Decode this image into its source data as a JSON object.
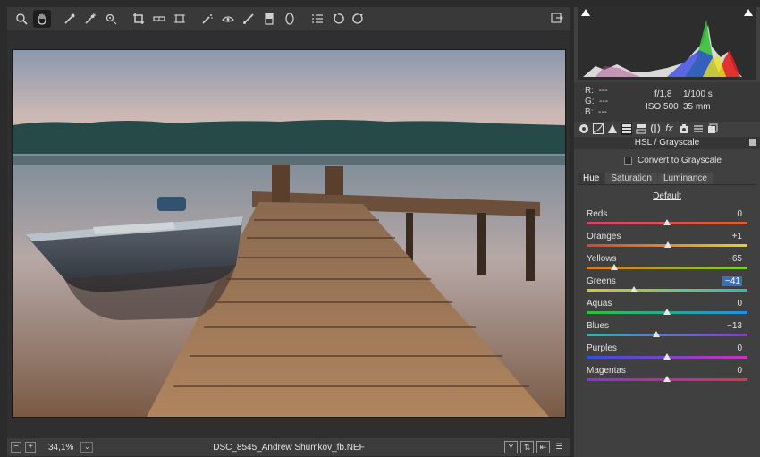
{
  "toolbar": {
    "tools": [
      {
        "name": "zoom-tool",
        "icon": "magnifier-icon"
      },
      {
        "name": "hand-tool",
        "icon": "hand-icon",
        "active": true
      },
      {
        "name": "white-balance-tool",
        "icon": "eyedropper-icon"
      },
      {
        "name": "color-sampler-tool",
        "icon": "eyedropper-plus-icon"
      },
      {
        "name": "targeted-adjustment-tool",
        "icon": "target-icon"
      },
      {
        "name": "crop-tool",
        "icon": "crop-icon"
      },
      {
        "name": "straighten-tool",
        "icon": "level-icon"
      },
      {
        "name": "transform-tool",
        "icon": "transform-icon"
      },
      {
        "name": "spot-removal-tool",
        "icon": "spot-removal-icon"
      },
      {
        "name": "red-eye-tool",
        "icon": "red-eye-icon"
      },
      {
        "name": "adjustment-brush-tool",
        "icon": "brush-icon"
      },
      {
        "name": "graduated-filter-tool",
        "icon": "gradient-icon"
      },
      {
        "name": "radial-filter-tool",
        "icon": "ellipse-icon"
      },
      {
        "name": "preferences-tool",
        "icon": "list-icon"
      },
      {
        "name": "rotate-left-tool",
        "icon": "rotate-ccw-icon"
      },
      {
        "name": "rotate-right-tool",
        "icon": "rotate-cw-icon"
      }
    ]
  },
  "status": {
    "zoom": "34,1%",
    "filename": "DSC_8545_Andrew Shumkov_fb.NEF"
  },
  "camera_info": {
    "r_label": "R:",
    "r_value": "---",
    "g_label": "G:",
    "g_value": "---",
    "b_label": "B:",
    "b_value": "---",
    "aperture": "f/1,8",
    "shutter": "1/100 s",
    "iso": "ISO 500",
    "focal": "35 mm"
  },
  "panel": {
    "title": "HSL / Grayscale",
    "convert_label": "Convert to Grayscale",
    "subtabs": [
      "Hue",
      "Saturation",
      "Luminance"
    ],
    "active_subtab": "Hue",
    "default_label": "Default",
    "sliders": [
      {
        "label": "Reds",
        "value": "0",
        "num": 0,
        "colors": [
          "#e0406b",
          "#e85a2c"
        ]
      },
      {
        "label": "Oranges",
        "value": "+1",
        "num": 1,
        "colors": [
          "#d9432f",
          "#e8d21a"
        ]
      },
      {
        "label": "Yellows",
        "value": "−65",
        "num": -65,
        "colors": [
          "#e07a20",
          "#7ad020"
        ]
      },
      {
        "label": "Greens",
        "value": "−41",
        "num": -41,
        "colors": [
          "#d8c72a",
          "#20c0b8"
        ],
        "selected": true
      },
      {
        "label": "Aquas",
        "value": "0",
        "num": 0,
        "colors": [
          "#30c040",
          "#2090e0"
        ]
      },
      {
        "label": "Blues",
        "value": "−13",
        "num": -13,
        "colors": [
          "#20b8c8",
          "#8a35d8"
        ]
      },
      {
        "label": "Purples",
        "value": "0",
        "num": 0,
        "colors": [
          "#3050e0",
          "#d030c0"
        ]
      },
      {
        "label": "Magentas",
        "value": "0",
        "num": 0,
        "colors": [
          "#9030e0",
          "#e03050"
        ]
      }
    ]
  }
}
